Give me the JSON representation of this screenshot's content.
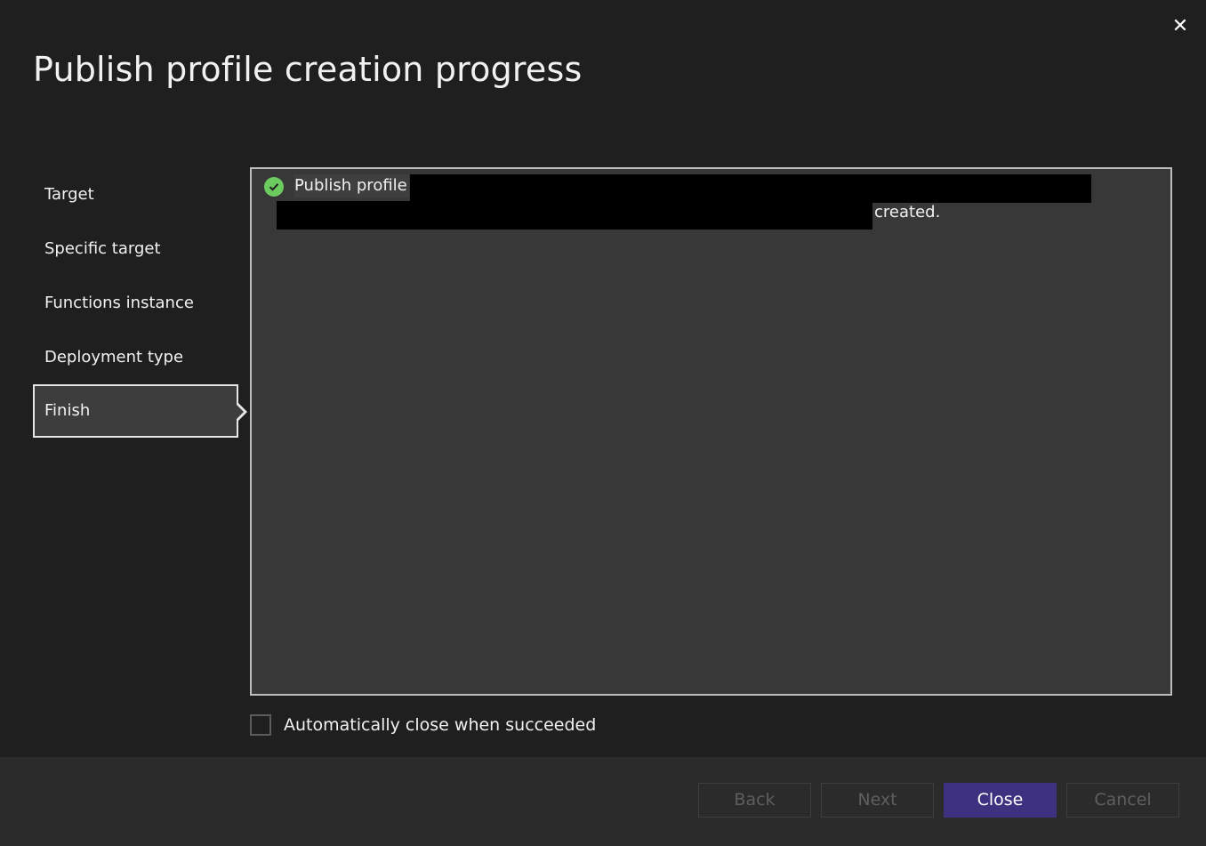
{
  "dialog": {
    "title": "Publish profile creation progress",
    "close_icon": "close-icon"
  },
  "nav": {
    "items": [
      {
        "label": "Target",
        "active": false
      },
      {
        "label": "Specific target",
        "active": false
      },
      {
        "label": "Functions instance",
        "active": false
      },
      {
        "label": "Deployment type",
        "active": false
      },
      {
        "label": "Finish",
        "active": true
      }
    ]
  },
  "progress": {
    "status_icon": "success-check-icon",
    "status_color": "#6ccb5f",
    "message_prefix": "Publish profile",
    "message_suffix": "created."
  },
  "options": {
    "auto_close_label": "Automatically close when succeeded",
    "auto_close_checked": false
  },
  "footer": {
    "back_label": "Back",
    "next_label": "Next",
    "close_label": "Close",
    "cancel_label": "Cancel",
    "accent_color": "#3e3280"
  }
}
